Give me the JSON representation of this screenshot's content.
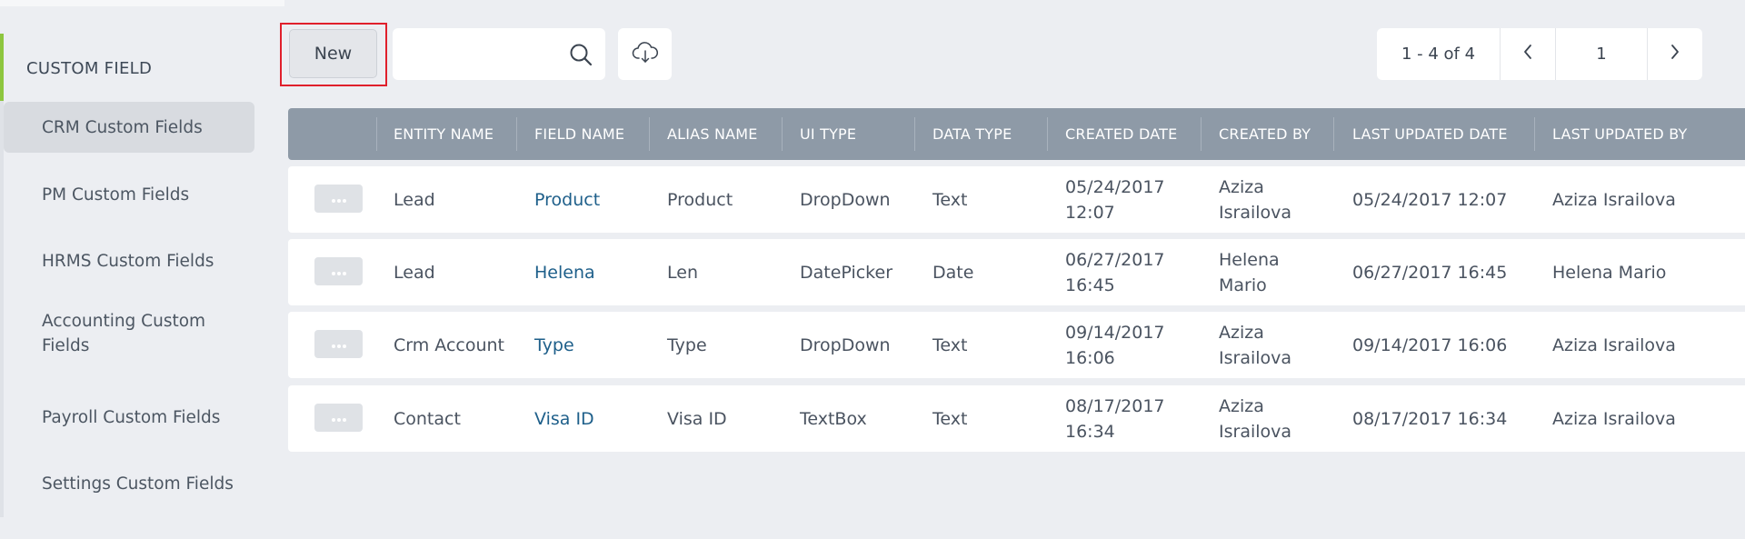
{
  "sidebar": {
    "title": "CUSTOM FIELD",
    "items": [
      {
        "label": "CRM Custom Fields",
        "active": true
      },
      {
        "label": "PM Custom Fields",
        "active": false
      },
      {
        "label": "HRMS Custom Fields",
        "active": false
      },
      {
        "label": "Accounting Custom Fields",
        "active": false
      },
      {
        "label": "Payroll Custom Fields",
        "active": false
      },
      {
        "label": "Settings Custom Fields",
        "active": false
      }
    ]
  },
  "toolbar": {
    "new_label": "New",
    "search_placeholder": "",
    "search_icon": "search-icon",
    "download_icon": "cloud-download-icon"
  },
  "pagination": {
    "range": "1 - 4 of 4",
    "current_page": "1",
    "prev_icon": "chevron-left-icon",
    "next_icon": "chevron-right-icon"
  },
  "table": {
    "columns": [
      "ENTITY NAME",
      "FIELD NAME",
      "ALIAS NAME",
      "UI TYPE",
      "DATA TYPE",
      "CREATED DATE",
      "CREATED BY",
      "LAST UPDATED DATE",
      "LAST UPDATED BY"
    ],
    "rows": [
      {
        "entity": "Lead",
        "field": "Product",
        "alias": "Product",
        "ui_type": "DropDown",
        "data_type": "Text",
        "created_date_1": "05/24/2017",
        "created_date_2": "12:07",
        "created_by_1": "Aziza",
        "created_by_2": "Israilova",
        "updated_date": "05/24/2017 12:07",
        "updated_by": "Aziza Israilova"
      },
      {
        "entity": "Lead",
        "field": "Helena",
        "alias": "Len",
        "ui_type": "DatePicker",
        "data_type": "Date",
        "created_date_1": "06/27/2017",
        "created_date_2": "16:45",
        "created_by_1": "Helena",
        "created_by_2": "Mario",
        "updated_date": "06/27/2017 16:45",
        "updated_by": "Helena Mario"
      },
      {
        "entity": "Crm Account",
        "field": "Type",
        "alias": "Type",
        "ui_type": "DropDown",
        "data_type": "Text",
        "created_date_1": "09/14/2017",
        "created_date_2": "16:06",
        "created_by_1": "Aziza",
        "created_by_2": "Israilova",
        "updated_date": "09/14/2017 16:06",
        "updated_by": "Aziza Israilova"
      },
      {
        "entity": "Contact",
        "field": "Visa ID",
        "alias": "Visa ID",
        "ui_type": "TextBox",
        "data_type": "Text",
        "created_date_1": "08/17/2017",
        "created_date_2": "16:34",
        "created_by_1": "Aziza",
        "created_by_2": "Israilova",
        "updated_date": "08/17/2017 16:34",
        "updated_by": "Aziza Israilova"
      }
    ]
  },
  "colors": {
    "accent": "#8dc63f",
    "header_bg": "#8e9aa7",
    "link": "#1e5f8a",
    "highlight_frame": "#e0202c"
  }
}
